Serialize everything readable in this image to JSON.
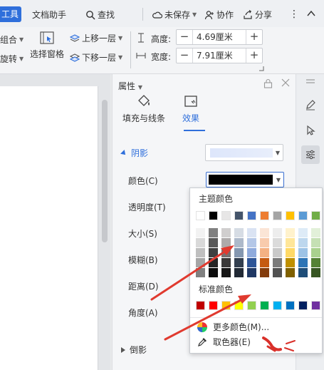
{
  "topbar": {
    "tab_partial": "工具",
    "doc_helper": "文档助手",
    "search": "查找",
    "unsaved": "未保存",
    "collab": "协作",
    "share": "分享"
  },
  "ribbon": {
    "group": "组合",
    "rotate": "旋转",
    "select_pane": "选择窗格",
    "bring_forward": "上移一层",
    "send_backward": "下移一层",
    "height_label": "高度:",
    "height_value": "4.69厘米",
    "width_label": "宽度:",
    "width_value": "7.91厘米"
  },
  "panel": {
    "title": "属性",
    "tab_fill": "填充与线条",
    "tab_effect": "效果",
    "section_shadow": "阴影",
    "color_label": "颜色(C)",
    "transparency_label": "透明度(T)",
    "size_label": "大小(S)",
    "blur_label": "模糊(B)",
    "distance_label": "距离(D)",
    "angle_label": "角度(A)",
    "section_reflection": "倒影"
  },
  "popup": {
    "theme_colors": "主题颜色",
    "standard_colors": "标准颜色",
    "more_colors": "更多颜色(M)...",
    "eyedropper": "取色器(E)",
    "theme_row": [
      "#ffffff",
      "#000000",
      "#e7e6e6",
      "#44546a",
      "#4472c4",
      "#ed7d31",
      "#a5a5a5",
      "#ffc000",
      "#5b9bd5",
      "#70ad47"
    ],
    "shade_cols": [
      [
        "#f2f2f2",
        "#d9d9d9",
        "#bfbfbf",
        "#a6a6a6",
        "#808080"
      ],
      [
        "#808080",
        "#595959",
        "#404040",
        "#262626",
        "#0d0d0d"
      ],
      [
        "#d0cece",
        "#aeaaaa",
        "#757171",
        "#3a3838",
        "#171616"
      ],
      [
        "#d6dce4",
        "#adb9ca",
        "#8497b0",
        "#333f4f",
        "#222a35"
      ],
      [
        "#dae3f3",
        "#b4c7e7",
        "#8faadc",
        "#2f5597",
        "#203864"
      ],
      [
        "#fbe5d6",
        "#f8cbad",
        "#f4b183",
        "#c55a11",
        "#843c0c"
      ],
      [
        "#ededed",
        "#dbdbdb",
        "#c9c9c9",
        "#7b7b7b",
        "#525252"
      ],
      [
        "#fff2cc",
        "#ffe699",
        "#ffd966",
        "#bf9000",
        "#7f6000"
      ],
      [
        "#deebf7",
        "#bdd7ee",
        "#9dc3e6",
        "#2e75b6",
        "#1f4e79"
      ],
      [
        "#e2f0d9",
        "#c5e0b4",
        "#a9d18e",
        "#548235",
        "#375623"
      ]
    ],
    "standard_row": [
      "#c00000",
      "#ff0000",
      "#ffc000",
      "#ffff00",
      "#92d050",
      "#00b050",
      "#00b0f0",
      "#0070c0",
      "#002060",
      "#7030a0"
    ]
  }
}
